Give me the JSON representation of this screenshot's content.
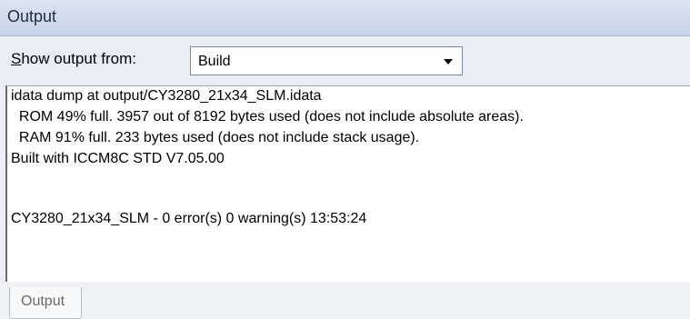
{
  "window": {
    "title": "Output"
  },
  "toolbar": {
    "show_label_mnemonic": "S",
    "show_label_rest": "how output from:",
    "source_selected": "Build"
  },
  "output": {
    "lines": [
      "idata dump at output/CY3280_21x34_SLM.idata",
      "  ROM 49% full. 3957 out of 8192 bytes used (does not include absolute areas).",
      "  RAM 91% full. 233 bytes used (does not include stack usage).",
      "Built with ICCM8C STD V7.05.00",
      "",
      "CY3280_21x34_SLM - 0 error(s) 0 warning(s) 13:53:24"
    ]
  },
  "tabs": [
    {
      "label": "Output"
    }
  ],
  "colors": {
    "titlebar": "#c6d3e6",
    "output_background": "#ffffff"
  }
}
